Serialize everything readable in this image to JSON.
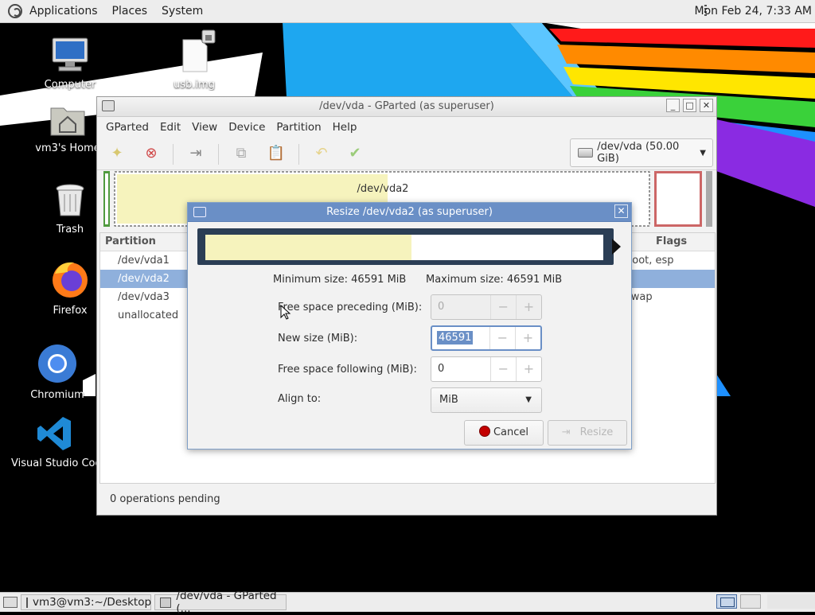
{
  "top_panel": {
    "applications": "Applications",
    "places": "Places",
    "system": "System",
    "clock": "Mon Feb 24,  7:33 AM"
  },
  "desktop": {
    "icons": [
      {
        "label": "Computer",
        "icon": "computer-icon"
      },
      {
        "label": "usb.img",
        "icon": "file-icon"
      },
      {
        "label": "vm3's Home",
        "icon": "home-folder-icon"
      },
      {
        "label": "Trash",
        "icon": "trash-icon"
      },
      {
        "label": "Firefox",
        "icon": "firefox-icon"
      },
      {
        "label": "Chromium",
        "icon": "chromium-icon"
      },
      {
        "label": "Visual Studio Code",
        "icon": "vscode-icon"
      }
    ]
  },
  "main_window": {
    "title": "/dev/vda - GParted (as superuser)",
    "menu": [
      "GParted",
      "Edit",
      "View",
      "Device",
      "Partition",
      "Help"
    ],
    "device": "/dev/vda (50.00 GiB)",
    "graphic_label": "/dev/vda2",
    "columns": {
      "partition": "Partition",
      "flags": "Flags"
    },
    "partitions": [
      {
        "name": "/dev/vda1",
        "flags": "boot, esp"
      },
      {
        "name": "/dev/vda2",
        "flags": ""
      },
      {
        "name": "/dev/vda3",
        "flags": "swap"
      },
      {
        "name": "unallocated",
        "flags": ""
      }
    ],
    "status": "0 operations pending"
  },
  "resize_dialog": {
    "title": "Resize /dev/vda2 (as superuser)",
    "min_size": "Minimum size: 46591 MiB",
    "max_size": "Maximum size: 46591 MiB",
    "used_fraction": 0.517,
    "preceding_label": "Free space preceding (MiB):",
    "preceding_value": "0",
    "new_size_label": "New size (MiB):",
    "new_size_value": "46591",
    "following_label": "Free space following (MiB):",
    "following_value": "0",
    "align_label": "Align to:",
    "align_value": "MiB",
    "cancel": "Cancel",
    "resize": "Resize"
  },
  "taskbar": {
    "tasks": [
      {
        "label": "vm3@vm3:~/Desktop"
      },
      {
        "label": "/dev/vda - GParted (..."
      }
    ]
  },
  "colors": {
    "dialog_title": "#6a8fc6",
    "selected_row": "#8fb0dc",
    "used_space": "#f6f3bd"
  }
}
